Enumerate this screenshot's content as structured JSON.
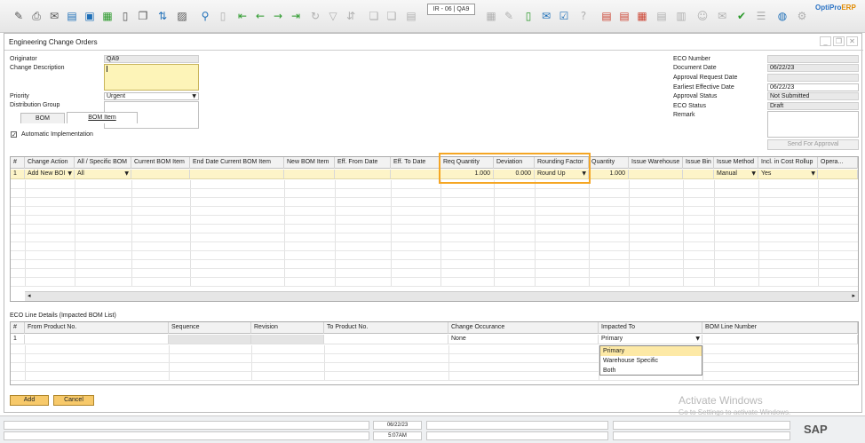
{
  "toolbar": {
    "record_box": "IR - 06 | QA9",
    "brand_main": "OptiPro",
    "brand_accent": "ERP"
  },
  "window": {
    "title": "Engineering Change Orders"
  },
  "header_left": {
    "originator_label": "Originator",
    "originator_value": "QA9",
    "change_description_label": "Change Description",
    "priority_label": "Priority",
    "priority_value": "Urgent",
    "distribution_group_label": "Distribution Group",
    "automatic_implementation_label": "Automatic Implementation",
    "automatic_implementation_checked": "✓"
  },
  "header_right": {
    "eco_number_label": "ECO Number",
    "document_date_label": "Document Date",
    "document_date_value": "06/22/23",
    "approval_request_date_label": "Approval Request Date",
    "earliest_effective_date_label": "Earliest Effective Date",
    "earliest_effective_date_value": "06/22/23",
    "approval_status_label": "Approval Status",
    "approval_status_value": "Not Submitted",
    "eco_status_label": "ECO Status",
    "eco_status_value": "Draft",
    "remark_label": "Remark",
    "send_for_approval_label": "Send For Approval"
  },
  "tabs": [
    {
      "label": "BOM"
    },
    {
      "label": "BOM Item"
    }
  ],
  "bom_grid": {
    "columns": [
      "#",
      "Change Action",
      "All / Specific BOM",
      "Current BOM Item",
      "End Date Current BOM Item",
      "New BOM Item",
      "Eff. From Date",
      "Eff. To Date",
      "Req Quantity",
      "Deviation",
      "Rounding Factor",
      "Quantity",
      "Issue Warehouse",
      "Issue Bin",
      "Issue Method",
      "Incl. in Cost Rollup",
      "Opera..."
    ],
    "row1": {
      "num": "1",
      "change_action": "Add New BOI",
      "all_specific": "All",
      "req_quantity": "1.000",
      "deviation": "0.000",
      "rounding_factor": "Round Up",
      "quantity": "1.000",
      "issue_method": "Manual",
      "incl_cost_rollup": "Yes"
    }
  },
  "eco_lines": {
    "title": "ECO Line Details (Impacted BOM List)",
    "columns": [
      "#",
      "From Product No.",
      "Sequence",
      "Revision",
      "To Product No.",
      "Change Occurance",
      "Impacted To",
      "BOM Line Number"
    ],
    "row1": {
      "num": "1",
      "change_occurance": "None",
      "impacted_to": "Primary"
    },
    "dropdown_options": [
      "Primary",
      "Warehouse Specific",
      "Both"
    ]
  },
  "buttons": {
    "add": "Add",
    "cancel": "Cancel"
  },
  "status_bar": {
    "date": "06/22/23",
    "time": "5:07AM"
  },
  "watermark": {
    "title": "Activate Windows",
    "subtitle": "Go to Settings to activate Windows."
  },
  "sap_logo": "SAP"
}
